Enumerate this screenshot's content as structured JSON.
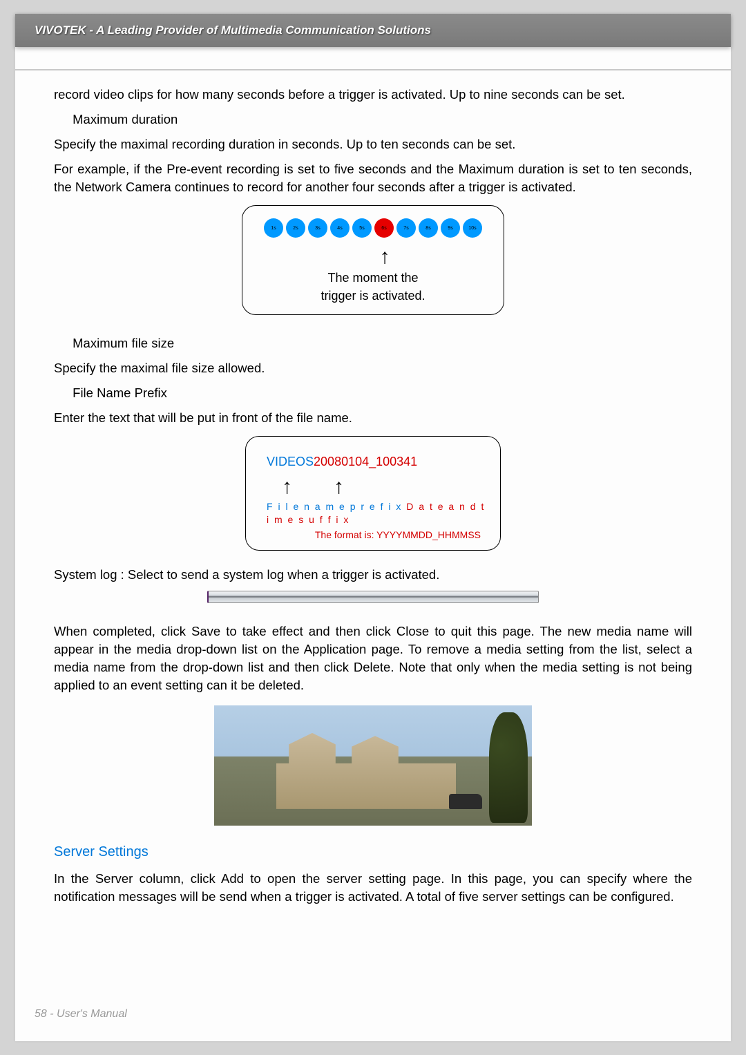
{
  "header": {
    "title": "VIVOTEK - A Leading Provider of Multimedia Communication Solutions"
  },
  "body": {
    "intro_cont": "record video clips for how many seconds before a trigger is activated. Up to nine seconds can be set.",
    "max_duration_label": "Maximum duration",
    "max_duration_desc": "Specify the maximal recording duration in seconds. Up to ten seconds can be set.",
    "example_para": "For example, if the Pre-event recording is set to five seconds and the Maximum duration is set to ten seconds, the Network Camera continues to record for another four seconds after a trigger is activated.",
    "diagram1": {
      "dot_labels": [
        "1s",
        "2s",
        "3s",
        "4s",
        "5s",
        "6s",
        "7s",
        "8s",
        "9s",
        "10s"
      ],
      "trigger_index": 5,
      "caption_line1": "The moment the",
      "caption_line2": "trigger is activated."
    },
    "max_file_size_label": "Maximum file size",
    "max_file_size_desc": "Specify the maximal file size allowed.",
    "file_prefix_label": "File Name Prefix",
    "file_prefix_desc": "Enter the text that will be put in front of the file name.",
    "diagram2": {
      "prefix": "VIDEOS",
      "suffix": "20080104_100341",
      "label_left": "F i l e   n a m e   p r e f i x",
      "label_right": "D a t e   a n d   t i m e   s u f f i x",
      "format_note": "The format is: YYYYMMDD_HHMMSS"
    },
    "system_log_line": "System log  :  Select to send a system log when a trigger is activated.",
    "completion_para": "When completed, click Save to take effect and then click Close to quit this page. The new media name will appear in the media drop-down list on the Application page. To remove a media setting from the list, select a media name from the drop-down list and then click Delete. Note that only when the media setting is not being applied to an event setting can it be deleted.",
    "server_settings_heading": "Server Settings",
    "server_settings_para": "In the Server column, click Add to open the server setting page. In this page, you can specify where the notification messages will be send when a trigger is activated. A total of five server settings can be configured."
  },
  "footer": {
    "page_info": "58 - User's Manual"
  }
}
